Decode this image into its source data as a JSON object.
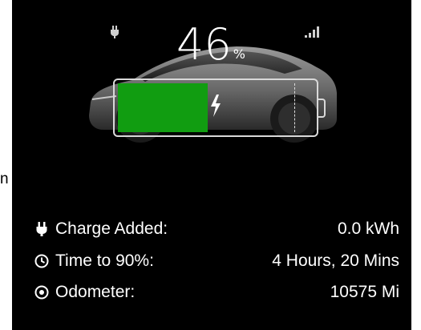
{
  "charge": {
    "percent": "46",
    "percent_symbol": "%",
    "level": 0.46,
    "target_level": 0.9
  },
  "colors": {
    "fill": "#119d11",
    "background": "#000000",
    "text": "#ffffff"
  },
  "status_icons": [
    "plug-icon",
    "signal-icon",
    "lightning-bolt-icon"
  ],
  "stats": [
    {
      "icon": "plug-icon",
      "label": "Charge Added:",
      "value": "0.0 kWh"
    },
    {
      "icon": "clock-icon",
      "label": "Time to 90%:",
      "value": "4 Hours, 20 Mins"
    },
    {
      "icon": "odometer-icon",
      "label": "Odometer:",
      "value": "10575 Mi"
    }
  ]
}
